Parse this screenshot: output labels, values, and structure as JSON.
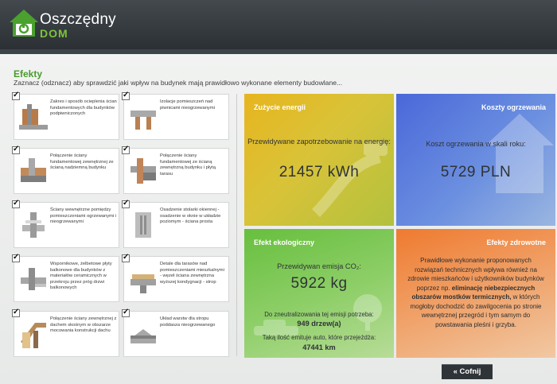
{
  "app": {
    "brand_top": "Oszczędny",
    "brand_bottom": "DOM"
  },
  "section": {
    "title": "Efekty",
    "subtitle": "Zaznacz (odznacz) aby sprawdzić jaki wpływ na budynek mają prawidłowo wykonane elementy budowlane..."
  },
  "items": [
    {
      "text": "Zakres i sposób ocieplenia ścian fundamentowych dla budynków podpiwniczonych",
      "checked": true
    },
    {
      "text": "Izolacje pomieszczeń nad piwnicami nieogrzewanymi",
      "checked": true
    },
    {
      "text": "Połączenie ściany fundamentowej zewnętrznej ze ścianą nadziemną budynku",
      "checked": true
    },
    {
      "text": "Połączenie ściany fundamentowej ze ścianą zewnętrzną budynku i płytą tarasu",
      "checked": true
    },
    {
      "text": "Ściany wewnętrzne pomiędzy pomieszczeniami ogrzewanymi i nieogrzewanymi",
      "checked": true
    },
    {
      "text": "Osadzenie stolarki okiennej - osadzenie w oknie w układzie poziomym - ściana prosta",
      "checked": true
    },
    {
      "text": "Wspornikowe, żelbetowe płyty balkonowe dla budynków z materiałów ceramicznych w przekroju przez próg drzwi balkonowych",
      "checked": true
    },
    {
      "text": "Detale dla tarasów nad pomieszczeniami mieszkalnymi - węzeł ściana zewnętrzna wyższej kondygnacji - strop",
      "checked": true
    },
    {
      "text": "Połączenie ściany zewnętrznej z dachem skośnym w obszarze mocowania konstrukcji dachu",
      "checked": true
    },
    {
      "text": "Układ warstw dla stropu poddasza nieogrzewanego",
      "checked": true
    }
  ],
  "panels": {
    "energy": {
      "title": "Zużycie energii",
      "label": "Przewidywane zapotrzebowanie na energię:",
      "value": "21457 kWh"
    },
    "cost": {
      "title": "Koszty ogrzewania",
      "label": "Koszt ogrzewania w skali roku:",
      "value": "5729 PLN"
    },
    "eco": {
      "title": "Efekt ekologiczny",
      "label": "Przewidywan emisja CO₂:",
      "value": "5922 kg",
      "trees_label": "Do zneutralizowania tej emisji potrzeba:",
      "trees_value": "949 drzew(a)",
      "cars_label": "Taką ilość emituje auto, które przejeżdża:",
      "cars_value": "47441 km"
    },
    "health": {
      "title": "Efekty zdrowotne",
      "text_1": "Prawidłowe wykonanie proponowanych rozwiązań technicznych wpływa również na zdrowie mieszkańców i użytkowników budynków poprzez np.",
      "text_bold": "eliminację niebezpiecznych obszarów mostków termicznych,",
      "text_2": "w których mogłoby dochodzić do zawilgocenia po stronie wewnętrznej przegród i tym samym do powstawania pleśni i grzyba."
    }
  },
  "buttons": {
    "back": "« Cofnij"
  },
  "colors": {
    "accent_green": "#4a9a2e",
    "header_dark": "#2b3034",
    "energy": "#e7b51f",
    "cost": "#4a68d9",
    "eco": "#67bf3e",
    "health": "#ef7a2f"
  },
  "icons": {
    "logo": "house-logo-icon",
    "checkbox": "checkmark-icon"
  }
}
